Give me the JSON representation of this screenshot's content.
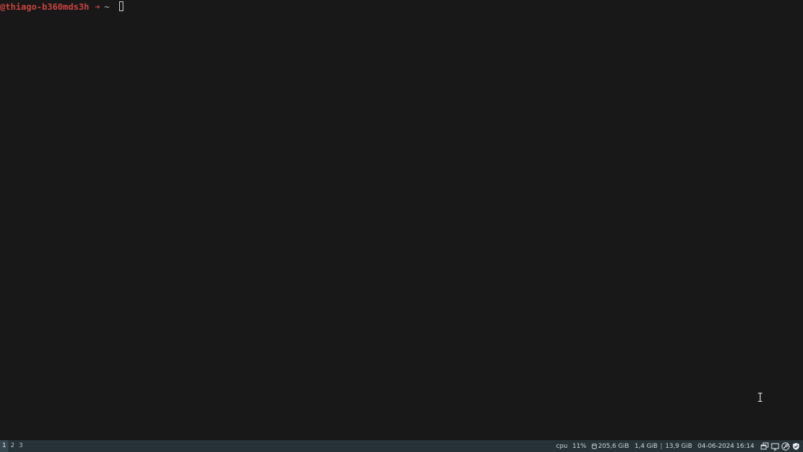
{
  "terminal": {
    "prompt_host": "@thiago-b360mds3h",
    "prompt_arrow": "➜",
    "prompt_dir": "~"
  },
  "statusbar": {
    "workspaces": [
      "1",
      "2",
      "3"
    ],
    "active_workspace": "1",
    "cpu_label": "cpu",
    "cpu_value": "11%",
    "disk_icon": "disk-icon",
    "disk_value": "205,6 GiB",
    "mem_used": "1,4 GiB",
    "mem_separator": "|",
    "mem_total": "13,9 GiB",
    "datetime": "04-06-2024 16:14",
    "tray_icons": [
      "windows-icon",
      "display-icon",
      "steam-icon",
      "shield-icon"
    ]
  },
  "colors": {
    "background": "#181818",
    "bar_background": "#263238",
    "prompt_color": "#c9433f"
  }
}
